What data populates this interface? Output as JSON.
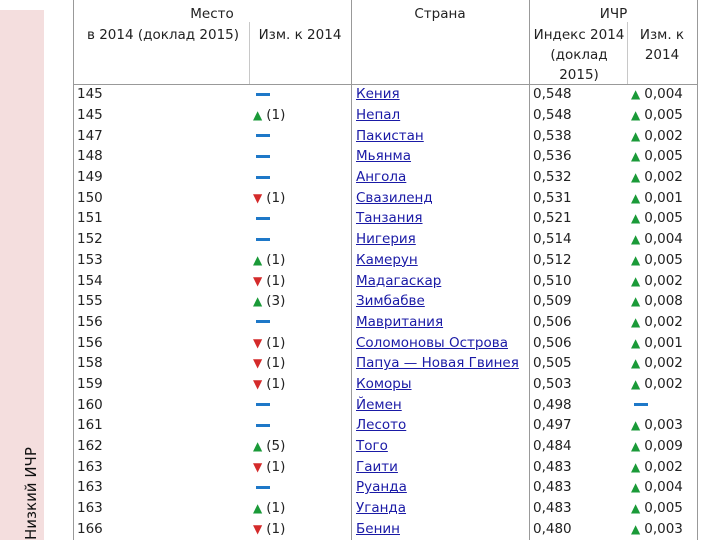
{
  "headers": {
    "place": "Место",
    "rank_2014": "в 2014 (доклад 2015)",
    "change_2014": "Изм. к 2014",
    "country": "Страна",
    "hdi": "ИЧР",
    "index_2014": "Индекс 2014 (доклад 2015)",
    "index_change": "Изм. к 2014"
  },
  "side_label": "Низкий ИЧР",
  "colors": {
    "up": "#1a9a38",
    "down": "#d42a2a",
    "same": "#1e78c8",
    "link": "#1a1aa6",
    "band": "#f4dede"
  },
  "rows": [
    {
      "rank": "145",
      "chg_dir": "same",
      "chg": "",
      "country": "Кения",
      "index": "0,548",
      "ichg_dir": "up",
      "ichg": "0,004"
    },
    {
      "rank": "145",
      "chg_dir": "up",
      "chg": "(1)",
      "country": "Непал",
      "index": "0,548",
      "ichg_dir": "up",
      "ichg": "0,005"
    },
    {
      "rank": "147",
      "chg_dir": "same",
      "chg": "",
      "country": "Пакистан",
      "index": "0,538",
      "ichg_dir": "up",
      "ichg": "0,002"
    },
    {
      "rank": "148",
      "chg_dir": "same",
      "chg": "",
      "country": "Мьянма",
      "index": "0,536",
      "ichg_dir": "up",
      "ichg": "0,005"
    },
    {
      "rank": "149",
      "chg_dir": "same",
      "chg": "",
      "country": "Ангола",
      "index": "0,532",
      "ichg_dir": "up",
      "ichg": "0,002"
    },
    {
      "rank": "150",
      "chg_dir": "down",
      "chg": "(1)",
      "country": "Свазиленд",
      "index": "0,531",
      "ichg_dir": "up",
      "ichg": "0,001"
    },
    {
      "rank": "151",
      "chg_dir": "same",
      "chg": "",
      "country": "Танзания",
      "index": "0,521",
      "ichg_dir": "up",
      "ichg": "0,005"
    },
    {
      "rank": "152",
      "chg_dir": "same",
      "chg": "",
      "country": "Нигерия",
      "index": "0,514",
      "ichg_dir": "up",
      "ichg": "0,004"
    },
    {
      "rank": "153",
      "chg_dir": "up",
      "chg": "(1)",
      "country": "Камерун",
      "index": "0,512",
      "ichg_dir": "up",
      "ichg": "0,005"
    },
    {
      "rank": "154",
      "chg_dir": "down",
      "chg": "(1)",
      "country": "Мадагаскар",
      "index": "0,510",
      "ichg_dir": "up",
      "ichg": "0,002"
    },
    {
      "rank": "155",
      "chg_dir": "up",
      "chg": "(3)",
      "country": "Зимбабве",
      "index": "0,509",
      "ichg_dir": "up",
      "ichg": "0,008"
    },
    {
      "rank": "156",
      "chg_dir": "same",
      "chg": "",
      "country": "Мавритания",
      "index": "0,506",
      "ichg_dir": "up",
      "ichg": "0,002"
    },
    {
      "rank": "156",
      "chg_dir": "down",
      "chg": "(1)",
      "country": "Соломоновы Острова",
      "index": "0,506",
      "ichg_dir": "up",
      "ichg": "0,001"
    },
    {
      "rank": "158",
      "chg_dir": "down",
      "chg": "(1)",
      "country": "Папуа — Новая Гвинея",
      "index": "0,505",
      "ichg_dir": "up",
      "ichg": "0,002"
    },
    {
      "rank": "159",
      "chg_dir": "down",
      "chg": "(1)",
      "country": "Коморы",
      "index": "0,503",
      "ichg_dir": "up",
      "ichg": "0,002"
    },
    {
      "rank": "160",
      "chg_dir": "same",
      "chg": "",
      "country": "Йемен",
      "index": "0,498",
      "ichg_dir": "same",
      "ichg": ""
    },
    {
      "rank": "161",
      "chg_dir": "same",
      "chg": "",
      "country": "Лесото",
      "index": "0,497",
      "ichg_dir": "up",
      "ichg": "0,003"
    },
    {
      "rank": "162",
      "chg_dir": "up",
      "chg": "(5)",
      "country": "Того",
      "index": "0,484",
      "ichg_dir": "up",
      "ichg": "0,009"
    },
    {
      "rank": "163",
      "chg_dir": "down",
      "chg": "(1)",
      "country": "Гаити",
      "index": "0,483",
      "ichg_dir": "up",
      "ichg": "0,002"
    },
    {
      "rank": "163",
      "chg_dir": "same",
      "chg": "",
      "country": "Руанда",
      "index": "0,483",
      "ichg_dir": "up",
      "ichg": "0,004"
    },
    {
      "rank": "163",
      "chg_dir": "up",
      "chg": "(1)",
      "country": "Уганда",
      "index": "0,483",
      "ichg_dir": "up",
      "ichg": "0,005"
    },
    {
      "rank": "166",
      "chg_dir": "down",
      "chg": "(1)",
      "country": "Бенин",
      "index": "0,480",
      "ichg_dir": "up",
      "ichg": "0,003"
    }
  ]
}
